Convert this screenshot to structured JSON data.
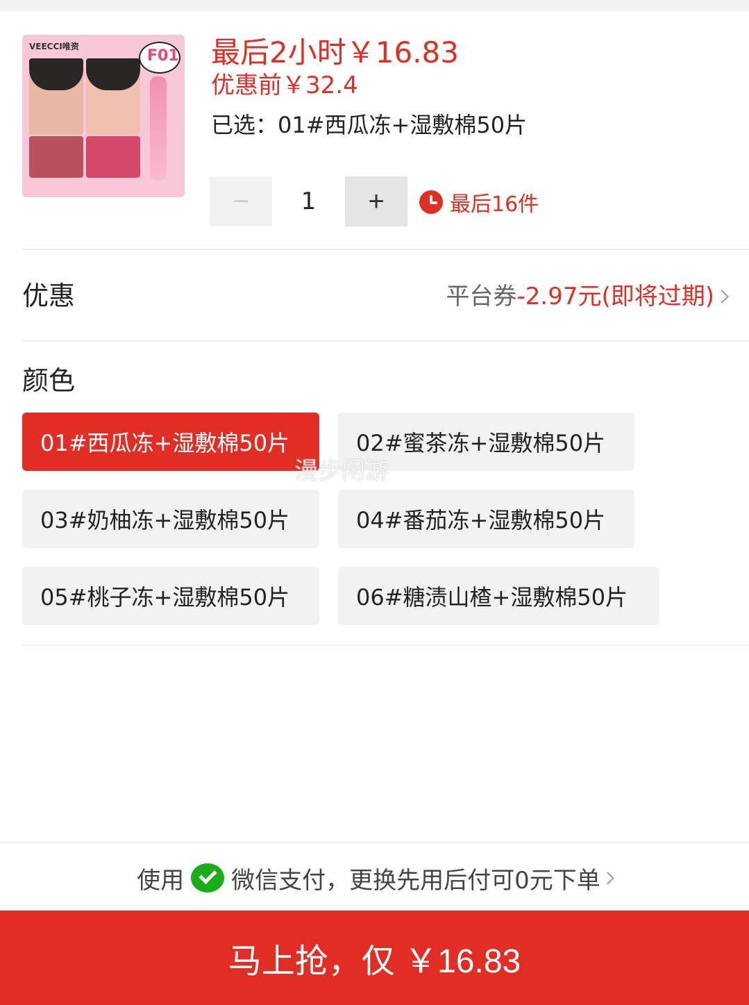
{
  "product": {
    "image_brand": "VEECCI唯资",
    "image_badge": "F01",
    "price_now": "最后2小时￥16.83",
    "price_before": "优惠前￥32.4",
    "selected_label": "已选：",
    "selected_value": "01#西瓜冻+湿敷棉50片"
  },
  "quantity": {
    "minus_icon": "−",
    "value": "1",
    "plus_icon": "+",
    "stock_text": "最后16件"
  },
  "coupon": {
    "label": "优惠",
    "prefix": "平台券",
    "amount": "-2.97元(即将过期)"
  },
  "color": {
    "label": "颜色",
    "selected_index": 0,
    "options": [
      "01#西瓜冻+湿敷棉50片",
      "02#蜜茶冻+湿敷棉50片",
      "03#奶柚冻+湿敷棉50片",
      "04#番茄冻+湿敷棉50片",
      "05#桃子冻+湿敷棉50片",
      "06#糖渍山楂+湿敷棉50片"
    ]
  },
  "watermark": "漫步闲游",
  "payment": {
    "prefix": "使用",
    "text": "微信支付，更换先用后付可0元下单"
  },
  "buy_button": "马上抢，仅 ￥16.83",
  "colors": {
    "accent": "#e02e24",
    "option_bg": "#f2f2f2",
    "wechat": "#1aad19"
  }
}
